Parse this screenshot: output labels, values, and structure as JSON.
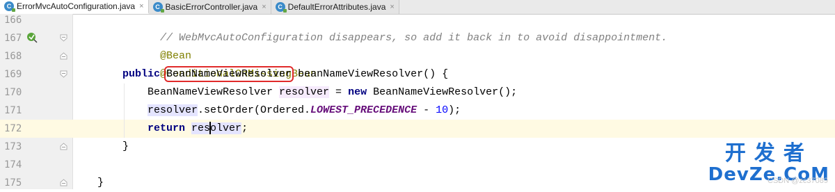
{
  "tabs": [
    {
      "label": "ErrorMvcAutoConfiguration.java",
      "icon": "java-class-icon",
      "active": true
    },
    {
      "label": "BasicErrorController.java",
      "icon": "java-class-icon",
      "active": false
    },
    {
      "label": "DefaultErrorAttributes.java",
      "icon": "java-class-icon",
      "active": false
    }
  ],
  "tab_close_glyph": "×",
  "file_icon_letter": "C",
  "lines": {
    "l166": {
      "no": "166",
      "comment": "// WebMvcAutoConfiguration disappears, so add it back in to avoid disappointment."
    },
    "l167": {
      "no": "167",
      "annotation": "@Bean"
    },
    "l168": {
      "no": "168",
      "annotation": "@ConditionalOnMissingBean"
    },
    "l169": {
      "no": "169",
      "kw": "public",
      "type_boxed": "BeanNameViewResolver",
      "rest": " beanNameViewResolver() {"
    },
    "l170": {
      "no": "170",
      "type": "BeanNameViewResolver ",
      "var": "resolver",
      "eq": " = ",
      "kw": "new",
      "rest": " BeanNameViewResolver();"
    },
    "l171": {
      "no": "171",
      "var": "resolver",
      "call": ".setOrder(Ordered.",
      "const": "LOWEST_PRECEDENCE",
      "minus": " - ",
      "num": "10",
      "end": ");"
    },
    "l172": {
      "no": "172",
      "kw": "return",
      "var_a": "res",
      "var_b": "olver",
      "end": ";"
    },
    "l173": {
      "no": "173",
      "brace": "}"
    },
    "l174": {
      "no": "174"
    },
    "l175": {
      "no": "175",
      "brace": "}"
    }
  },
  "colors": {
    "keyword": "#000080",
    "annotation": "#808000",
    "comment": "#808080",
    "constant": "#660e7a",
    "number": "#0000ff",
    "highlight_box": "#e02a2a",
    "current_line": "#fffae3"
  },
  "watermark": {
    "cn": "开发者",
    "en": "DevZe.CoM"
  },
  "csdn_mark": "CSDN @zc37089"
}
